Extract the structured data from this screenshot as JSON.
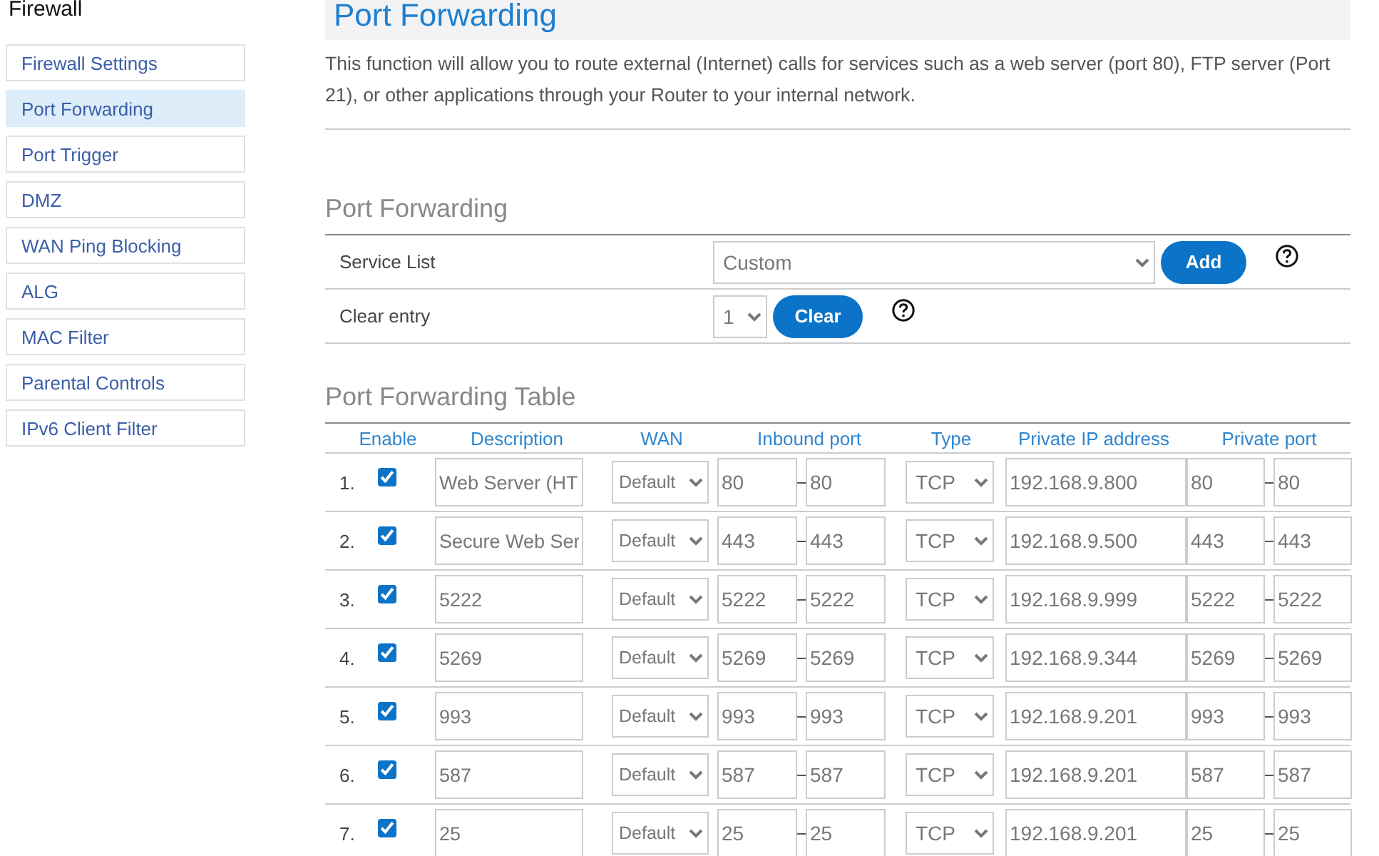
{
  "sidebar": {
    "title": "Firewall",
    "items": [
      {
        "label": "Firewall Settings",
        "selected": false
      },
      {
        "label": "Port Forwarding",
        "selected": true
      },
      {
        "label": "Port Trigger",
        "selected": false
      },
      {
        "label": "DMZ",
        "selected": false
      },
      {
        "label": "WAN Ping Blocking",
        "selected": false
      },
      {
        "label": "ALG",
        "selected": false
      },
      {
        "label": "MAC Filter",
        "selected": false
      },
      {
        "label": "Parental Controls",
        "selected": false
      },
      {
        "label": "IPv6 Client Filter",
        "selected": false
      }
    ]
  },
  "page": {
    "title": "Port Forwarding",
    "description": "This function will allow you to route external (Internet) calls for services such as a web server (port 80), FTP server (Port 21), or other applications through your Router to your internal network."
  },
  "port_forwarding": {
    "heading": "Port Forwarding",
    "service_list": {
      "label": "Service List",
      "value": "Custom",
      "button": "Add"
    },
    "clear_entry": {
      "label": "Clear entry",
      "value": "1",
      "button": "Clear"
    }
  },
  "table": {
    "heading": "Port Forwarding Table",
    "columns": [
      "Enable",
      "Description",
      "WAN",
      "Inbound port",
      "Type",
      "Private IP address",
      "Private port"
    ],
    "rows": [
      {
        "index": "1.",
        "enabled": true,
        "description": "Web Server (HT",
        "wan": "Default",
        "inbound_from": "80",
        "inbound_to": "80",
        "type": "TCP",
        "private_ip": "192.168.9.800",
        "private_from": "80",
        "private_to": "80"
      },
      {
        "index": "2.",
        "enabled": true,
        "description": "Secure Web Ser",
        "wan": "Default",
        "inbound_from": "443",
        "inbound_to": "443",
        "type": "TCP",
        "private_ip": "192.168.9.500",
        "private_from": "443",
        "private_to": "443"
      },
      {
        "index": "3.",
        "enabled": true,
        "description": "5222",
        "wan": "Default",
        "inbound_from": "5222",
        "inbound_to": "5222",
        "type": "TCP",
        "private_ip": "192.168.9.999",
        "private_from": "5222",
        "private_to": "5222"
      },
      {
        "index": "4.",
        "enabled": true,
        "description": "5269",
        "wan": "Default",
        "inbound_from": "5269",
        "inbound_to": "5269",
        "type": "TCP",
        "private_ip": "192.168.9.344",
        "private_from": "5269",
        "private_to": "5269"
      },
      {
        "index": "5.",
        "enabled": true,
        "description": "993",
        "wan": "Default",
        "inbound_from": "993",
        "inbound_to": "993",
        "type": "TCP",
        "private_ip": "192.168.9.201",
        "private_from": "993",
        "private_to": "993"
      },
      {
        "index": "6.",
        "enabled": true,
        "description": "587",
        "wan": "Default",
        "inbound_from": "587",
        "inbound_to": "587",
        "type": "TCP",
        "private_ip": "192.168.9.201",
        "private_from": "587",
        "private_to": "587"
      },
      {
        "index": "7.",
        "enabled": true,
        "description": "25",
        "wan": "Default",
        "inbound_from": "25",
        "inbound_to": "25",
        "type": "TCP",
        "private_ip": "192.168.9.201",
        "private_from": "25",
        "private_to": "25"
      }
    ]
  }
}
